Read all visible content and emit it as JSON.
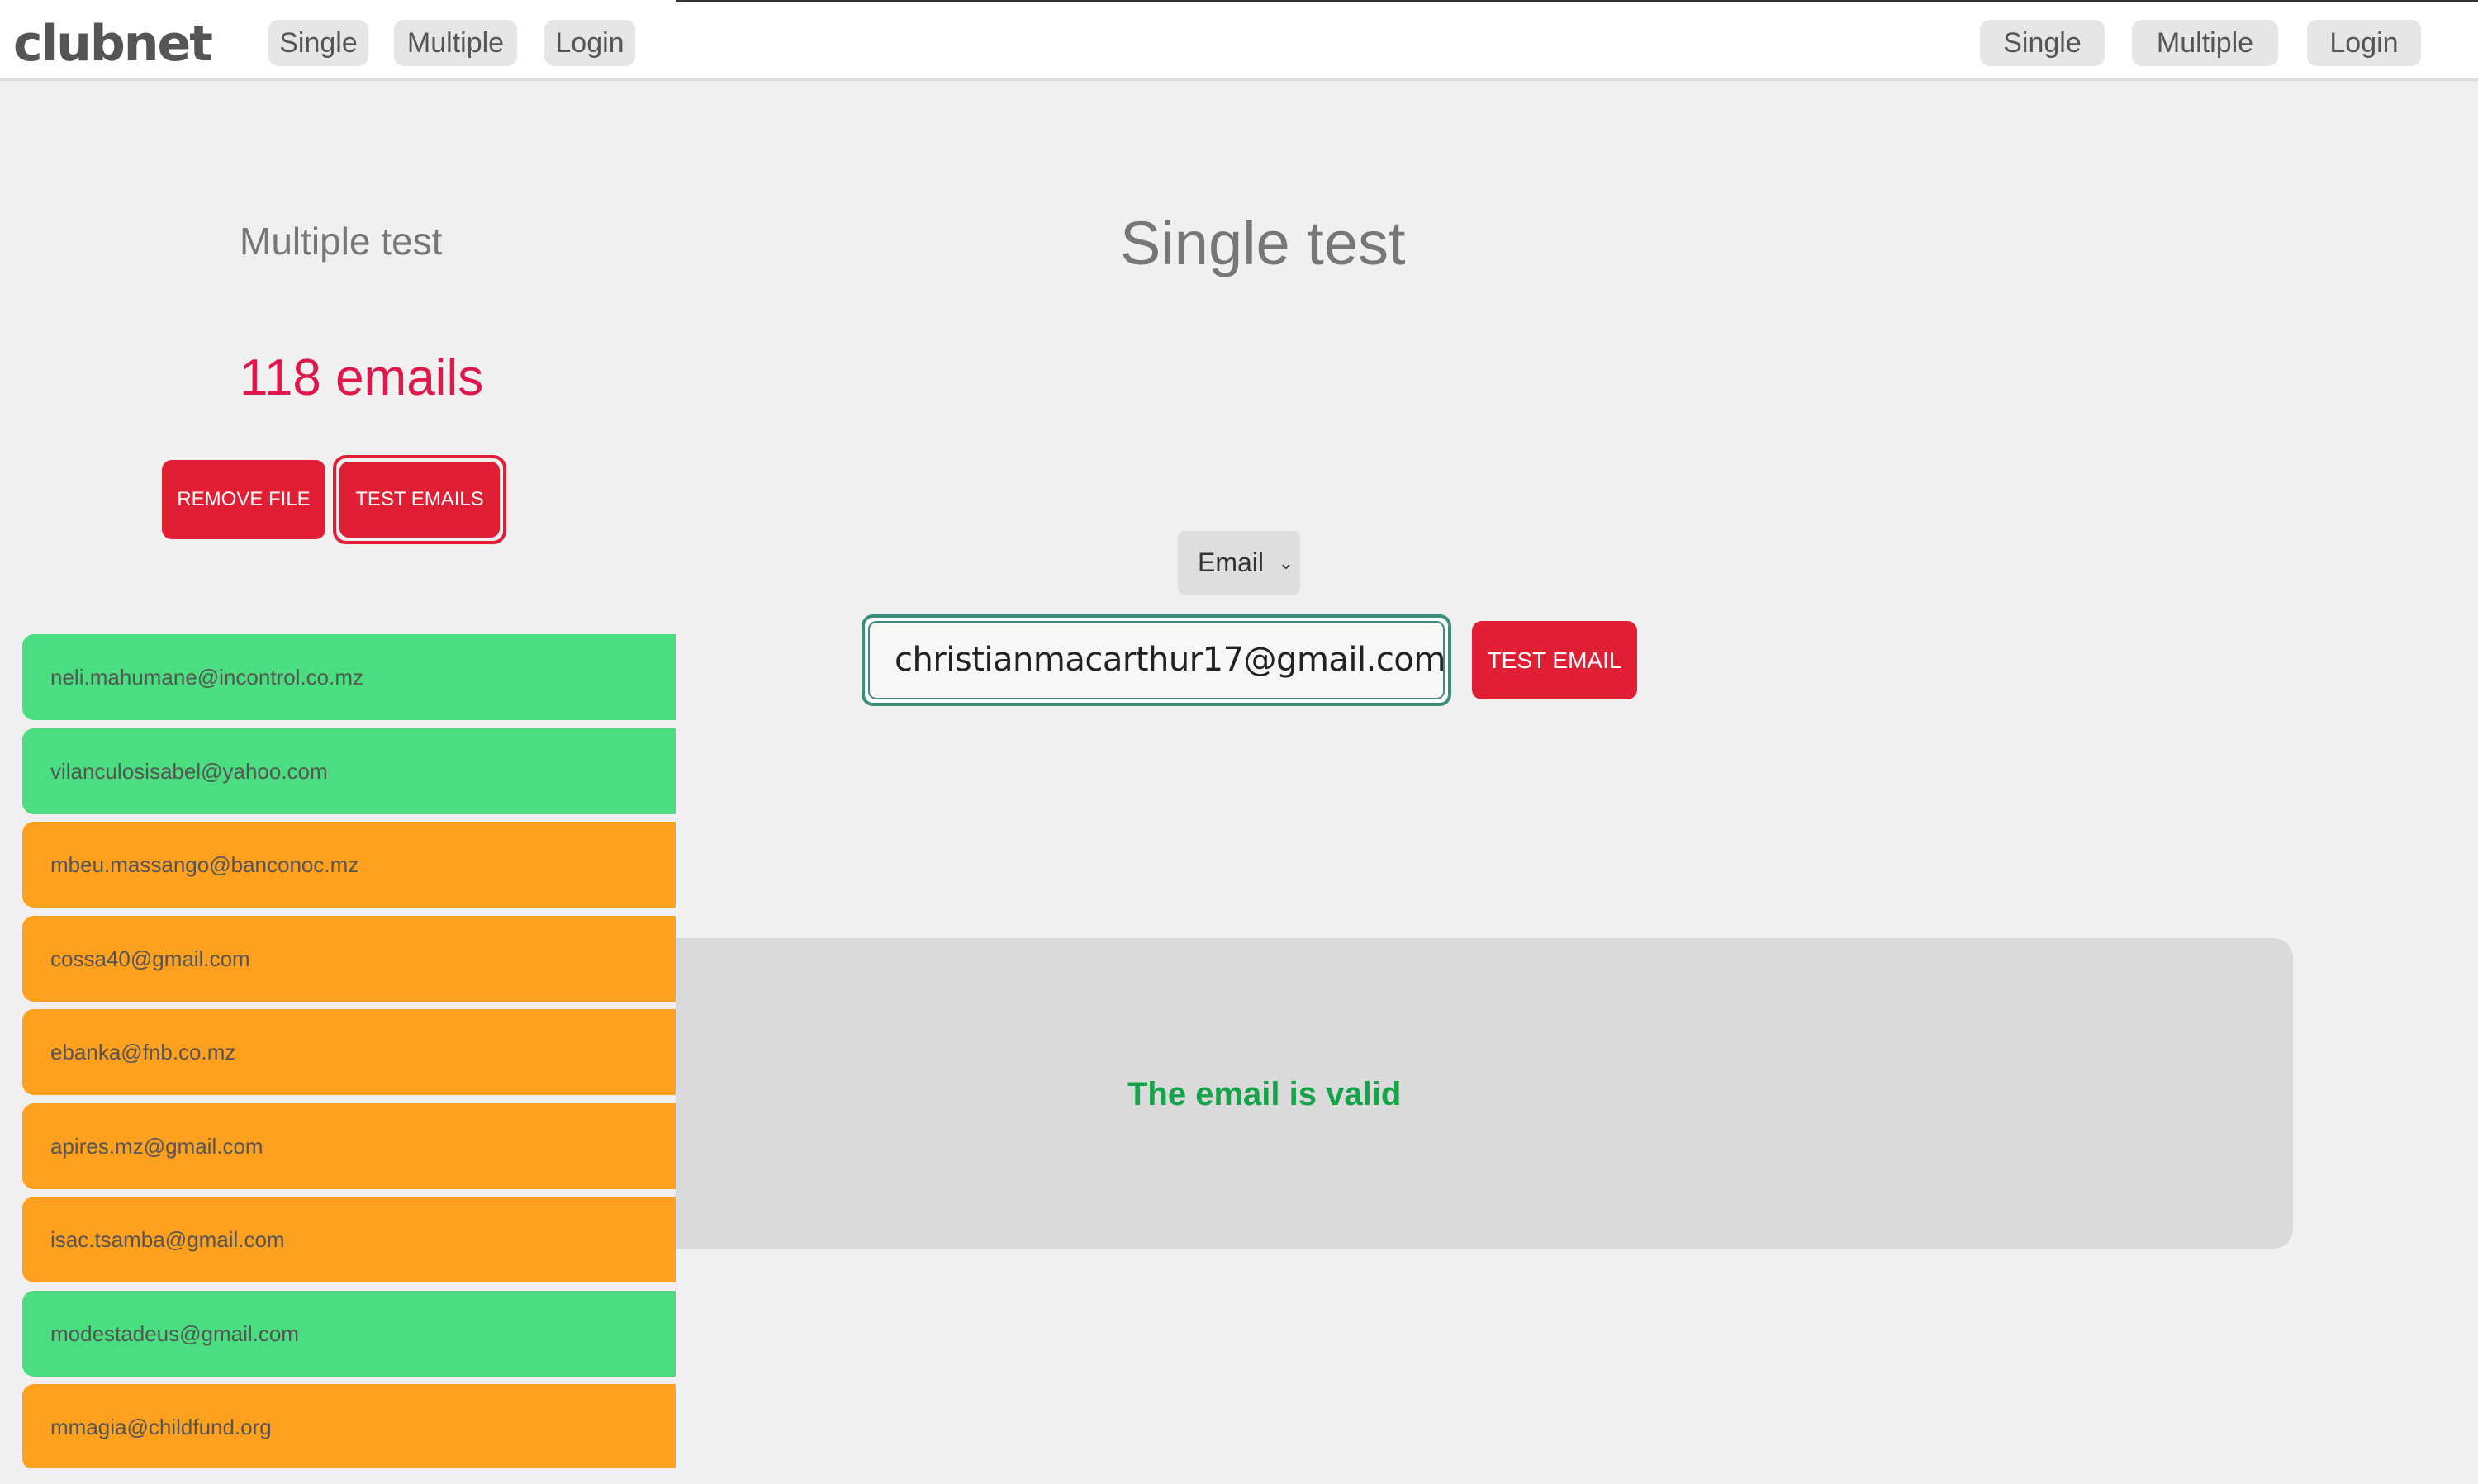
{
  "header": {
    "logo": "clubnet",
    "nav_left": [
      "Single",
      "Multiple",
      "Login"
    ],
    "nav_right": [
      "Single",
      "Multiple",
      "Login"
    ]
  },
  "multiple": {
    "title": "Multiple test",
    "count_text": "118 emails",
    "remove_label": "REMOVE FILE",
    "test_label": "TEST EMAILS",
    "emails": [
      {
        "address": "neli.mahumane@incontrol.co.mz",
        "status": "valid"
      },
      {
        "address": "vilanculosisabel@yahoo.com",
        "status": "valid"
      },
      {
        "address": "mbeu.massango@banconoc.mz",
        "status": "warn"
      },
      {
        "address": "cossa40@gmail.com",
        "status": "warn"
      },
      {
        "address": "ebanka@fnb.co.mz",
        "status": "warn"
      },
      {
        "address": "apires.mz@gmail.com",
        "status": "warn"
      },
      {
        "address": "isac.tsamba@gmail.com",
        "status": "warn"
      },
      {
        "address": "modestadeus@gmail.com",
        "status": "valid"
      },
      {
        "address": "mmagia@childfund.org",
        "status": "warn"
      }
    ]
  },
  "single": {
    "title": "Single test",
    "select_value": "Email",
    "input_value": "christianmacarthur17@gmail.com",
    "test_label": "TEST EMAIL",
    "result": "The email is valid"
  },
  "colors": {
    "valid": "#4ade80",
    "warn": "#ffa01e",
    "accent": "#e01e34",
    "success_text": "#16a34a"
  }
}
